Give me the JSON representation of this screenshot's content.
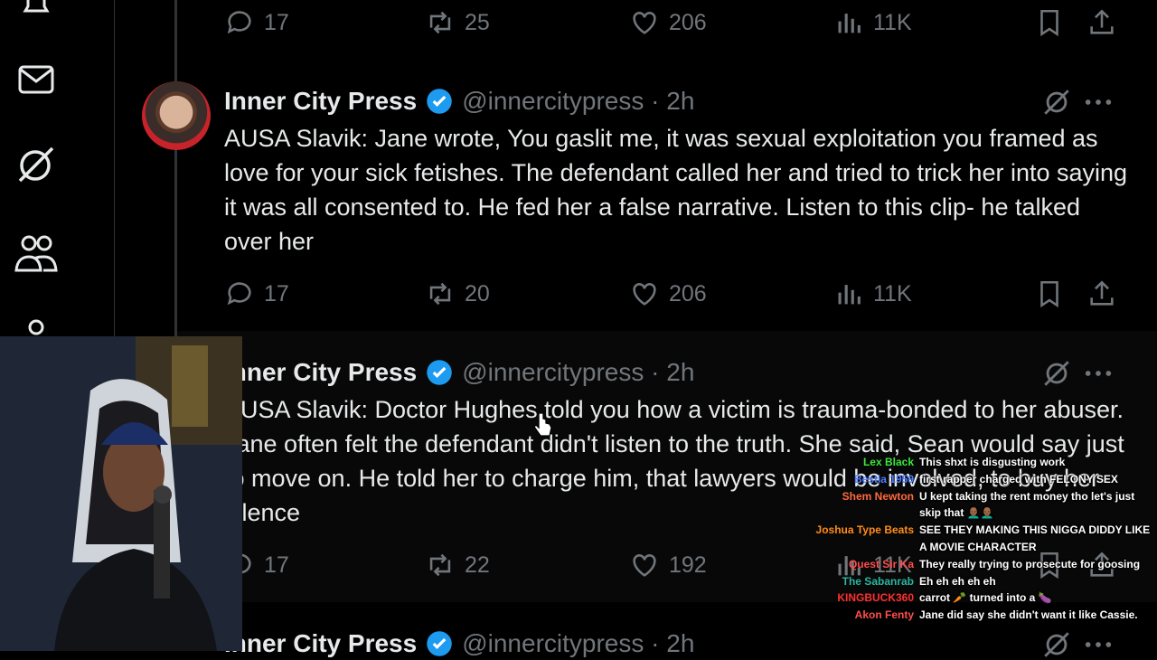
{
  "counts": {
    "tweet0": {
      "replies": "17",
      "reposts": "25",
      "likes": "206",
      "views": "11K"
    },
    "tweet1": {
      "replies": "17",
      "reposts": "20",
      "likes": "206",
      "views": "11K"
    },
    "tweet2": {
      "replies": "17",
      "reposts": "22",
      "likes": "192",
      "views": "11K"
    }
  },
  "tweets": [
    {
      "name": "Inner City Press",
      "handle": "@innercitypress · 2h",
      "text": "AUSA Slavik: Jane wrote, You gaslit me, it was sexual exploitation you framed as love for your sick fetishes. The defendant called her and tried to trick her into saying it was all consented to. He fed her a false narrative. Listen to this clip- he talked over her"
    },
    {
      "name": "Inner City Press",
      "handle": "@innercitypress · 2h",
      "text": "AUSA Slavik: Doctor Hughes told you how a victim is trauma-bonded to her abuser. Jane often felt the defendant didn't listen to the truth. She said, Sean would say just to move on.  He told her to charge him, that lawyers would be involved, to buy her silence"
    },
    {
      "name": "Inner City Press",
      "handle": "@innercitypress · 2h"
    }
  ],
  "chat": [
    {
      "user": "Lex Black",
      "color": "#39e639",
      "msg": "This shxt is disgusting work"
    },
    {
      "user": "Bestia 1959",
      "color": "#4f7cff",
      "msg": "first rapper charged with FELONY SEX"
    },
    {
      "user": "Shem Newton",
      "color": "#ff6a3d",
      "msg": "U kept taking the rent money tho let's just skip that 👨🏾‍🦲👨🏾‍🦲"
    },
    {
      "user": "Joshua Type Beats",
      "color": "#ff8c1a",
      "msg": "SEE THEY MAKING THIS NIGGA DIDDY LIKE A MOVIE CHARACTER"
    },
    {
      "user": "Quest Sir Ka",
      "color": "#ff4d4d",
      "msg": "They really trying to prosecute for goosing"
    },
    {
      "user": "The Sabanrab",
      "color": "#2bb5a0",
      "msg": "Eh eh eh eh eh"
    },
    {
      "user": "KINGBUCK360",
      "color": "#ff2e2e",
      "msg": "carrot 🥕 turned into a 🍆"
    },
    {
      "user": "Akon Fenty",
      "color": "#ff4d4d",
      "msg": "Jane did say she didn't want it like Cassie."
    }
  ],
  "colors": {
    "accent": "#1d9bf0",
    "muted": "#71767b",
    "text": "#e7e9ea"
  }
}
